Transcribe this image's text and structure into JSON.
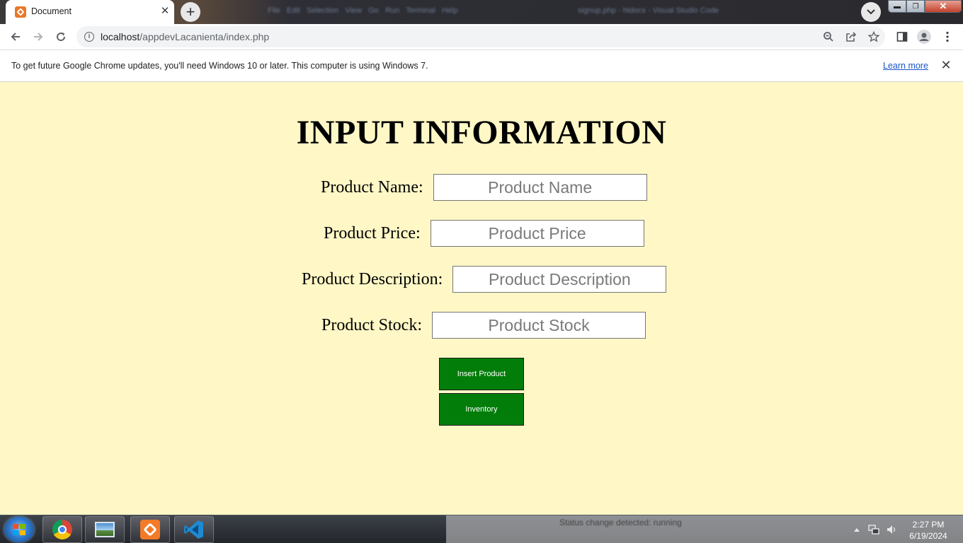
{
  "browser": {
    "tab_title": "Document",
    "tab_close": "✕",
    "new_tab": "+",
    "url_host": "localhost",
    "url_path": "/appdevLacanienta/index.php",
    "window_buttons": {
      "minimize": "▬",
      "restore": "❐",
      "close": "✕"
    }
  },
  "infobar": {
    "message": "To get future Google Chrome updates, you'll need Windows 10 or later. This computer is using Windows 7.",
    "link": "Learn more",
    "close": "✕"
  },
  "page": {
    "title": "INPUT INFORMATION",
    "fields": [
      {
        "label": "Product Name:",
        "placeholder": "Product Name",
        "value": ""
      },
      {
        "label": "Product Price:",
        "placeholder": "Product Price",
        "value": ""
      },
      {
        "label": "Product Description:",
        "placeholder": "Product Description",
        "value": ""
      },
      {
        "label": "Product Stock:",
        "placeholder": "Product Stock",
        "value": ""
      }
    ],
    "buttons": {
      "insert": "Insert Product",
      "inventory": "Inventory"
    },
    "background_color": "#fff8c6",
    "button_color": "#037d0a"
  },
  "taskbar": {
    "apps": [
      "chrome-icon",
      "photo-viewer-icon",
      "xampp-icon",
      "vscode-icon"
    ],
    "time": "2:27 PM",
    "date": "6/19/2024"
  }
}
